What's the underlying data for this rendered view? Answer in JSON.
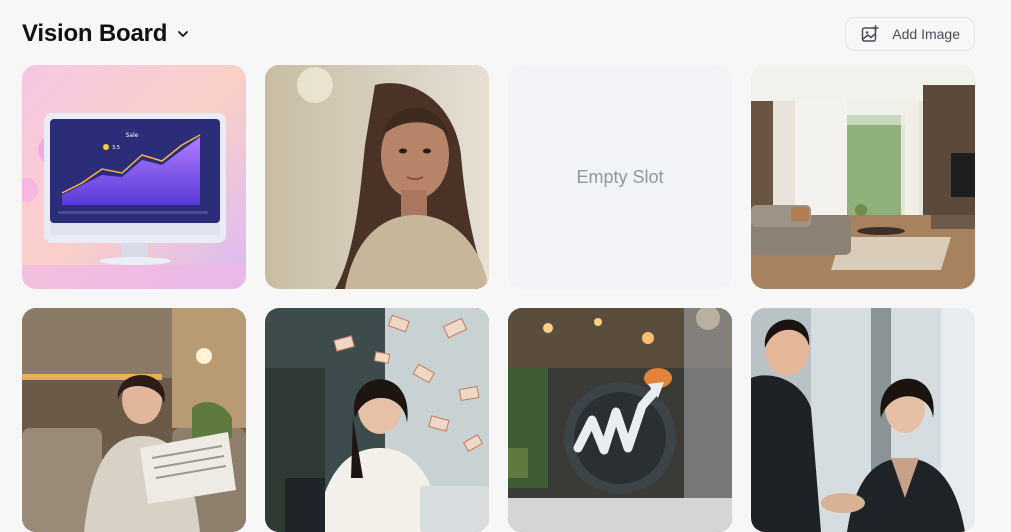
{
  "header": {
    "title": "Vision Board",
    "add_image_label": "Add Image"
  },
  "tiles": [
    {
      "kind": "image",
      "alt": "monitor-sales-chart-illustration"
    },
    {
      "kind": "image",
      "alt": "portrait-woman"
    },
    {
      "kind": "empty",
      "label": "Empty Slot"
    },
    {
      "kind": "image",
      "alt": "modern-living-room"
    },
    {
      "kind": "image",
      "alt": "woman-reading-newspaper"
    },
    {
      "kind": "image",
      "alt": "woman-laptop-flying-money"
    },
    {
      "kind": "image",
      "alt": "growth-logo-sculpture"
    },
    {
      "kind": "image",
      "alt": "business-handshake"
    }
  ],
  "monitor_chart": {
    "title": "Sale",
    "value": "3.5"
  },
  "colors": {
    "background": "#f7f7f8",
    "empty_slot": "#f1f3f6"
  }
}
